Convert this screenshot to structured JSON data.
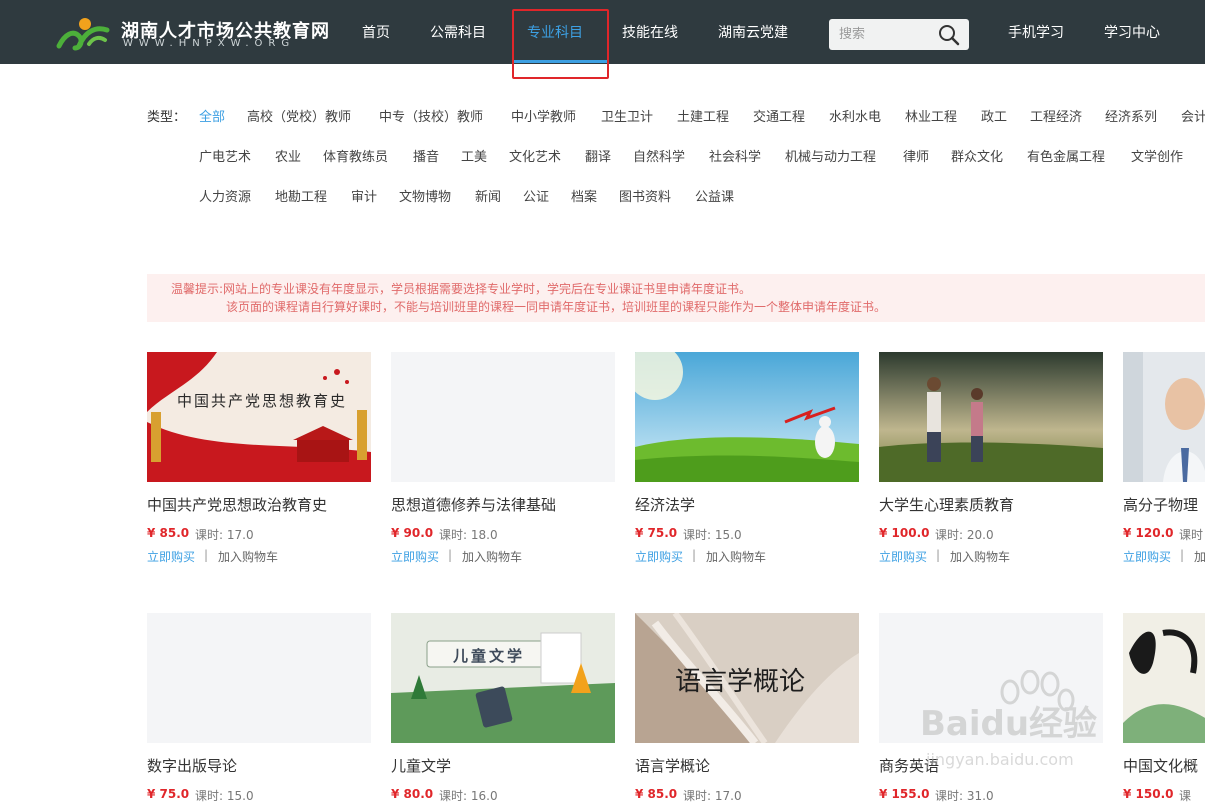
{
  "header": {
    "logo_title": "湖南人才市场公共教育网",
    "logo_sub": "WWW.HNPXW.ORG",
    "nav": [
      "首页",
      "公需科目",
      "专业科目",
      "技能在线",
      "湖南云党建"
    ],
    "active_nav": "专业科目",
    "search_placeholder": "搜索",
    "right_links": [
      "手机学习",
      "学习中心"
    ],
    "colors": {
      "bar": "#2f3a3f",
      "accent": "#3da0e3",
      "highlight_box": "#e0262a"
    }
  },
  "filter": {
    "label": "类型：",
    "active": "全部",
    "row1": [
      "全部",
      "高校（党校）教师",
      "中专（技校）教师",
      "中小学教师",
      "卫生卫计",
      "土建工程",
      "交通工程",
      "水利水电",
      "林业工程",
      "政工",
      "工程经济",
      "经济系列",
      "会计"
    ],
    "row2": [
      "广电艺术",
      "农业",
      "体育教练员",
      "播音",
      "工美",
      "文化艺术",
      "翻译",
      "自然科学",
      "社会科学",
      "机械与动力工程",
      "律师",
      "群众文化",
      "有色金属工程",
      "文学创作"
    ],
    "row3": [
      "人力资源",
      "地勘工程",
      "审计",
      "文物博物",
      "新闻",
      "公证",
      "档案",
      "图书资料",
      "公益课"
    ]
  },
  "notice": {
    "line1": "温馨提示:网站上的专业课没有年度显示，学员根据需要选择专业学时，学完后在专业课证书里申请年度证书。",
    "line2": "该页面的课程请自行算好课时，不能与培训班里的课程一同申请年度证书，培训班里的课程只能作为一个整体申请年度证书。"
  },
  "course_labels": {
    "buy": "立即购买",
    "separator": "|",
    "cart": "加入购物车"
  },
  "courses": [
    {
      "title": "中国共产党思想政治教育史",
      "price": "¥ 85.0",
      "hours": "课时: 17.0",
      "thumb_text": "中国共产党思想教育史",
      "thumb": "party-red"
    },
    {
      "title": "思想道德修养与法律基础",
      "price": "¥ 90.0",
      "hours": "课时: 18.0",
      "thumb_text": "",
      "thumb": "blank"
    },
    {
      "title": "经济法学",
      "price": "¥ 75.0",
      "hours": "课时: 15.0",
      "thumb_text": "",
      "thumb": "grass-sky"
    },
    {
      "title": "大学生心理素质教育",
      "price": "¥ 100.0",
      "hours": "课时: 20.0",
      "thumb_text": "",
      "thumb": "couple-field"
    },
    {
      "title": "高分子物理",
      "price": "¥ 120.0",
      "hours": "课时",
      "thumb_text": "",
      "thumb": "businessman"
    },
    {
      "title": "数字出版导论",
      "price": "¥ 75.0",
      "hours": "课时: 15.0",
      "thumb_text": "",
      "thumb": "blank"
    },
    {
      "title": "儿童文学",
      "price": "¥ 80.0",
      "hours": "课时: 16.0",
      "thumb_text": "儿童文学",
      "thumb": "kids-green"
    },
    {
      "title": "语言学概论",
      "price": "¥ 85.0",
      "hours": "课时: 17.0",
      "thumb_text": "语言学概论",
      "thumb": "book-pages"
    },
    {
      "title": "商务英语",
      "price": "¥ 155.0",
      "hours": "课时: 31.0",
      "thumb_text": "",
      "thumb": "blank"
    },
    {
      "title": "中国文化概",
      "price": "¥ 150.0",
      "hours": "课",
      "thumb_text": "",
      "thumb": "ink-art"
    }
  ],
  "watermark": {
    "brand": "Baidu经验",
    "url": "jingyan.baidu.com"
  }
}
